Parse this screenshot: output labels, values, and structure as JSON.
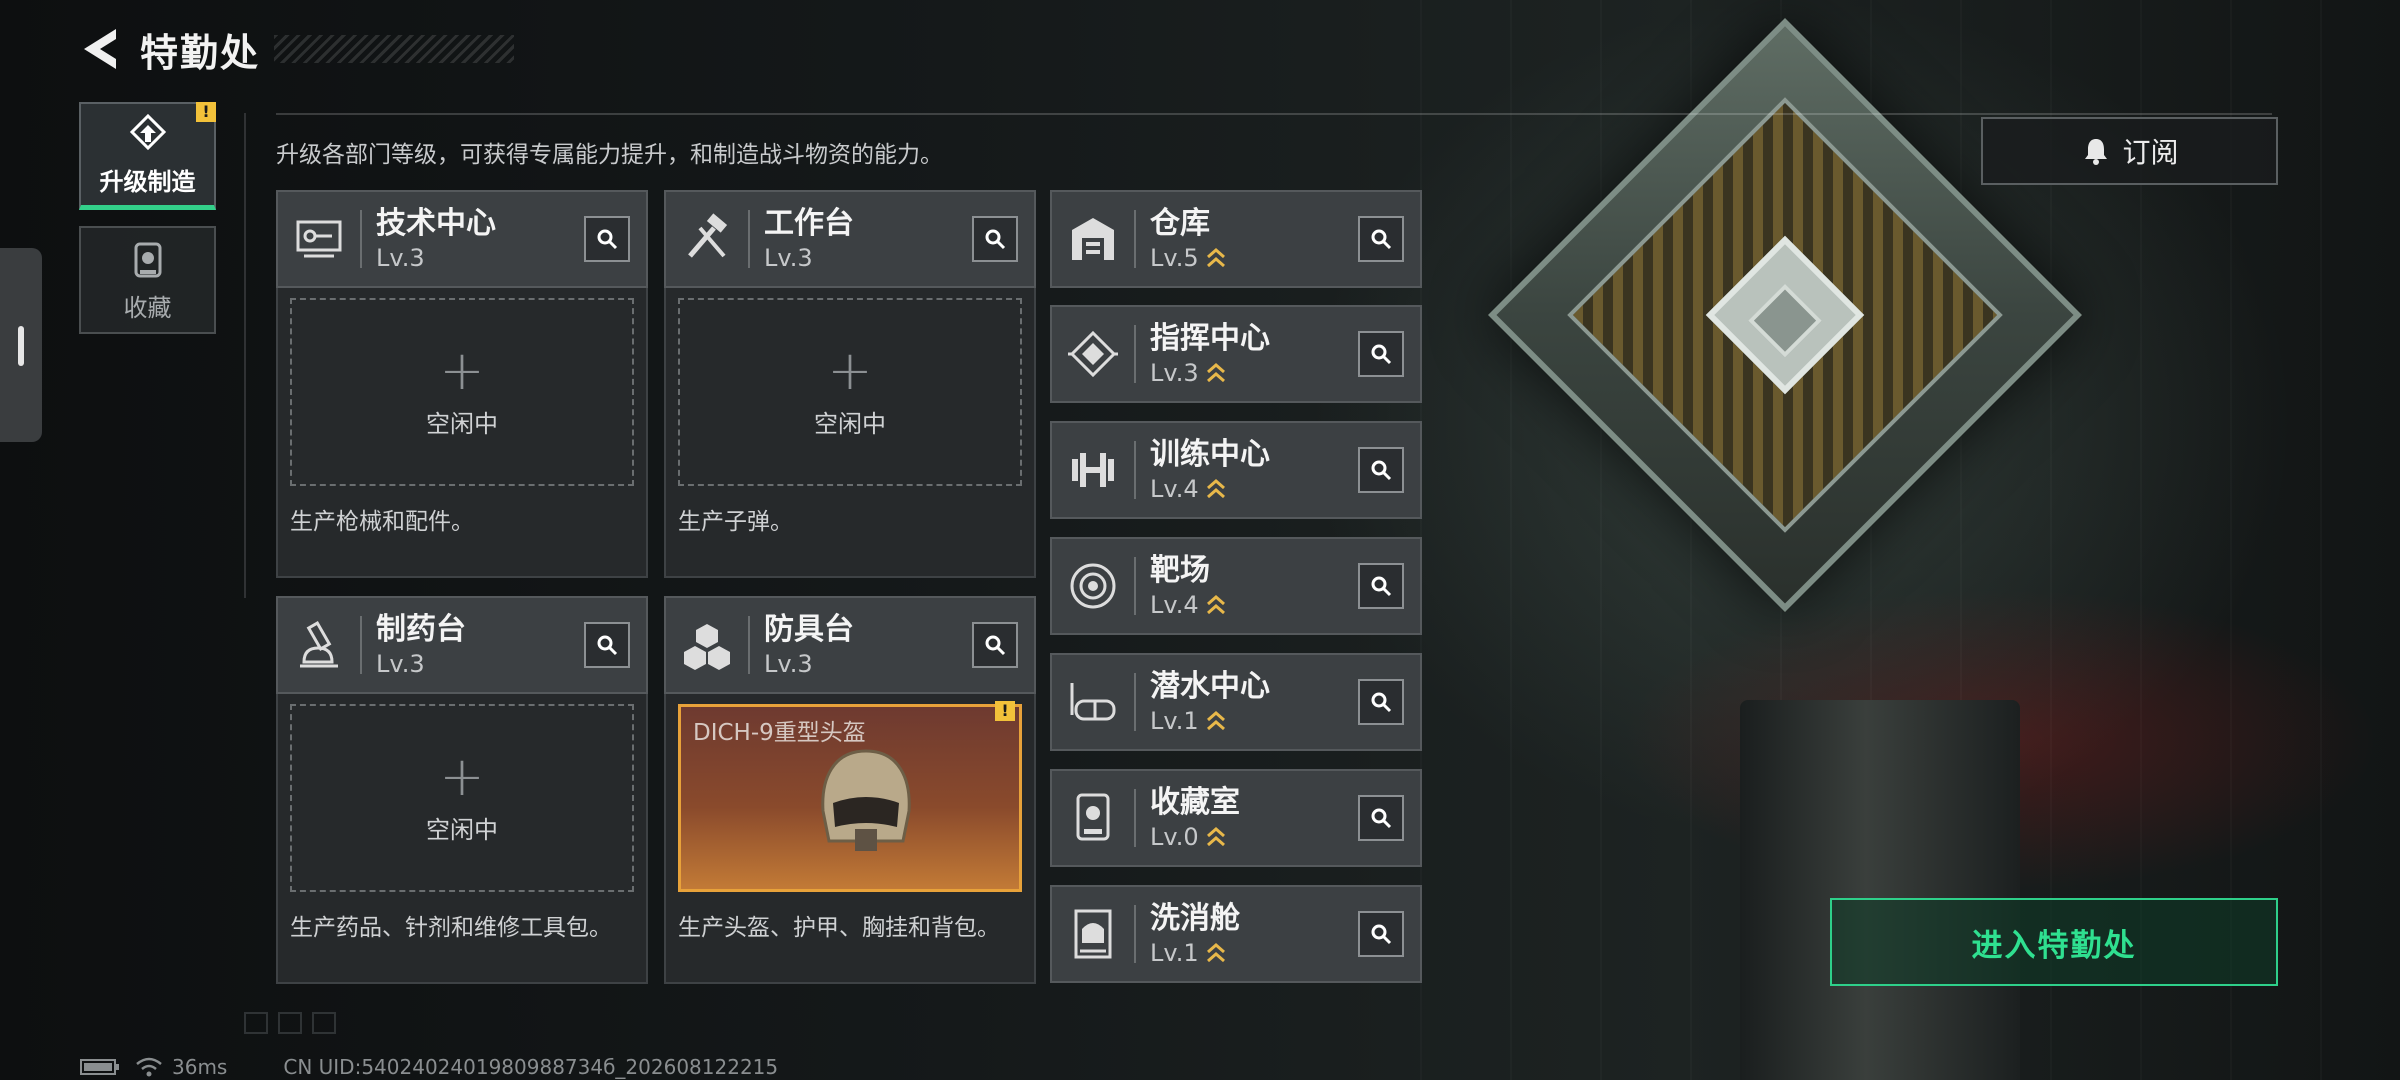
{
  "header": {
    "title": "特勤处"
  },
  "sidebar": {
    "tabs": [
      {
        "label": "升级制造",
        "active": true,
        "alert": "!"
      },
      {
        "label": "收藏",
        "active": false
      }
    ]
  },
  "subtitle": "升级各部门等级，可获得专属能力提升，和制造战斗物资的能力。",
  "subscribe": {
    "label": "订阅"
  },
  "workshops": [
    {
      "name": "技术中心",
      "level": "Lv.3",
      "slot_text": "空闲中",
      "desc": "生产枪械和配件。",
      "icon": "tech-center-icon"
    },
    {
      "name": "工作台",
      "level": "Lv.3",
      "slot_text": "空闲中",
      "desc": "生产子弹。",
      "icon": "workbench-icon"
    },
    {
      "name": "制药台",
      "level": "Lv.3",
      "slot_text": "空闲中",
      "desc": "生产药品、针剂和维修工具包。",
      "icon": "pharmacy-icon"
    },
    {
      "name": "防具台",
      "level": "Lv.3",
      "slot_item": "DICH-9重型头盔",
      "slot_alert": "!",
      "desc": "生产头盔、护甲、胸挂和背包。",
      "icon": "armor-bench-icon"
    }
  ],
  "facilities": [
    {
      "name": "仓库",
      "level": "Lv.5",
      "icon": "warehouse-icon"
    },
    {
      "name": "指挥中心",
      "level": "Lv.3",
      "icon": "command-center-icon"
    },
    {
      "name": "训练中心",
      "level": "Lv.4",
      "icon": "training-center-icon"
    },
    {
      "name": "靶场",
      "level": "Lv.4",
      "icon": "shooting-range-icon"
    },
    {
      "name": "潜水中心",
      "level": "Lv.1",
      "icon": "diving-center-icon"
    },
    {
      "name": "收藏室",
      "level": "Lv.0",
      "icon": "collection-room-icon"
    },
    {
      "name": "洗消舱",
      "level": "Lv.1",
      "icon": "decon-chamber-icon"
    }
  ],
  "enter_button": {
    "label": "进入特勤处"
  },
  "status": {
    "ping": "36ms",
    "uid": "CN UID:5402402401980988734б_202608122215"
  },
  "colors": {
    "accent_green": "#2fe090",
    "alert_yellow": "#f2c13a",
    "upgrade_gold": "#e8b84a"
  }
}
